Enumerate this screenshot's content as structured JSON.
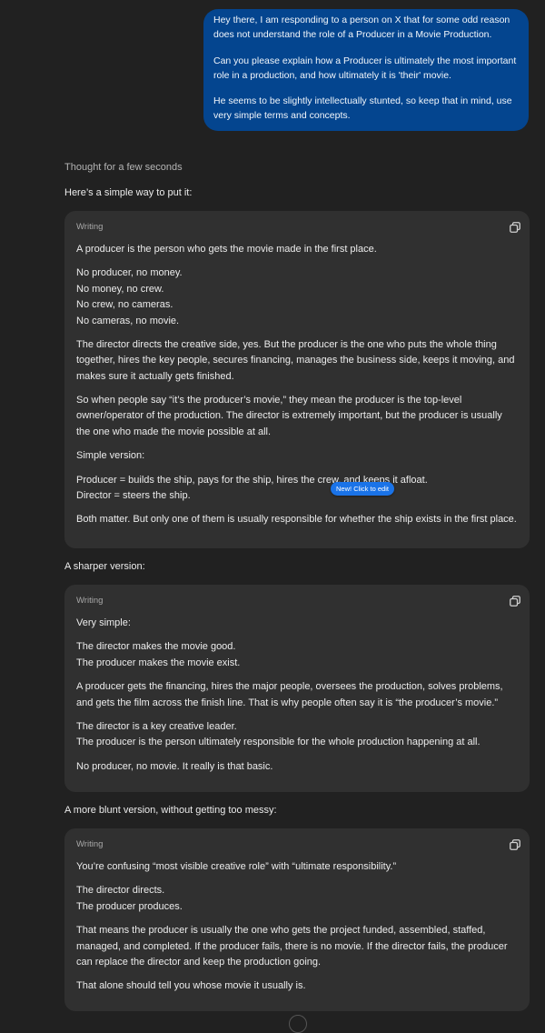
{
  "user_message": {
    "paragraphs": [
      "Hey there, I am responding to a person on X that for some odd reason does not understand the role of a Producer in a Movie Production.",
      "Can you please explain how a Producer is ultimately the most important role in a production, and how ultimately it is 'their' movie.",
      "He seems to be slightly intellectually stunted, so keep that in mind, use very simple terms and concepts."
    ]
  },
  "assistant": {
    "thought_label": "Thought for a few seconds",
    "intro": "Here’s a simple way to put it:",
    "sharper_label": "A sharper version:",
    "blunt_label": "A more blunt version, without getting too messy:"
  },
  "edit_badge": {
    "new": "New!",
    "text": "Click to edit"
  },
  "cards": [
    {
      "label": "Writing",
      "paragraphs": [
        [
          "A producer is the person who gets the movie made in the first place."
        ],
        [
          "No producer, no money.",
          "No money, no crew.",
          "No crew, no cameras.",
          "No cameras, no movie."
        ],
        [
          "The director directs the creative side, yes. But the producer is the one who puts the whole thing together, hires the key people, secures financing, manages the business side, keeps it moving, and makes sure it actually gets finished."
        ],
        [
          "So when people say “it’s the producer’s movie,” they mean the producer is the top-level owner/operator of the production. The director is extremely important, but the producer is usually the one who made the movie possible at all."
        ],
        [
          "Simple version:"
        ],
        [
          "Producer = builds the ship, pays for the ship, hires the crew, and keeps it afloat.",
          "Director = steers the ship."
        ],
        [
          "Both matter. But only one of them is usually responsible for whether the ship exists in the first place."
        ]
      ]
    },
    {
      "label": "Writing",
      "paragraphs": [
        [
          "Very simple:"
        ],
        [
          "The director makes the movie good.",
          "The producer makes the movie exist."
        ],
        [
          "A producer gets the financing, hires the major people, oversees the production, solves problems, and gets the film across the finish line. That is why people often say it is “the producer’s movie.”"
        ],
        [
          "The director is a key creative leader.",
          "The producer is the person ultimately responsible for the whole production happening at all."
        ],
        [
          "No producer, no movie. It really is that basic."
        ]
      ]
    },
    {
      "label": "Writing",
      "paragraphs": [
        [
          "You’re confusing “most visible creative role” with “ultimate responsibility.”"
        ],
        [
          "The director directs.",
          "The producer produces."
        ],
        [
          "That means the producer is usually the one who gets the project funded, assembled, staffed, managed, and completed. If the producer fails, there is no movie. If the director fails, the producer can replace the director and keep the production going."
        ],
        [
          "That alone should tell you whose movie it usually is."
        ]
      ]
    }
  ]
}
